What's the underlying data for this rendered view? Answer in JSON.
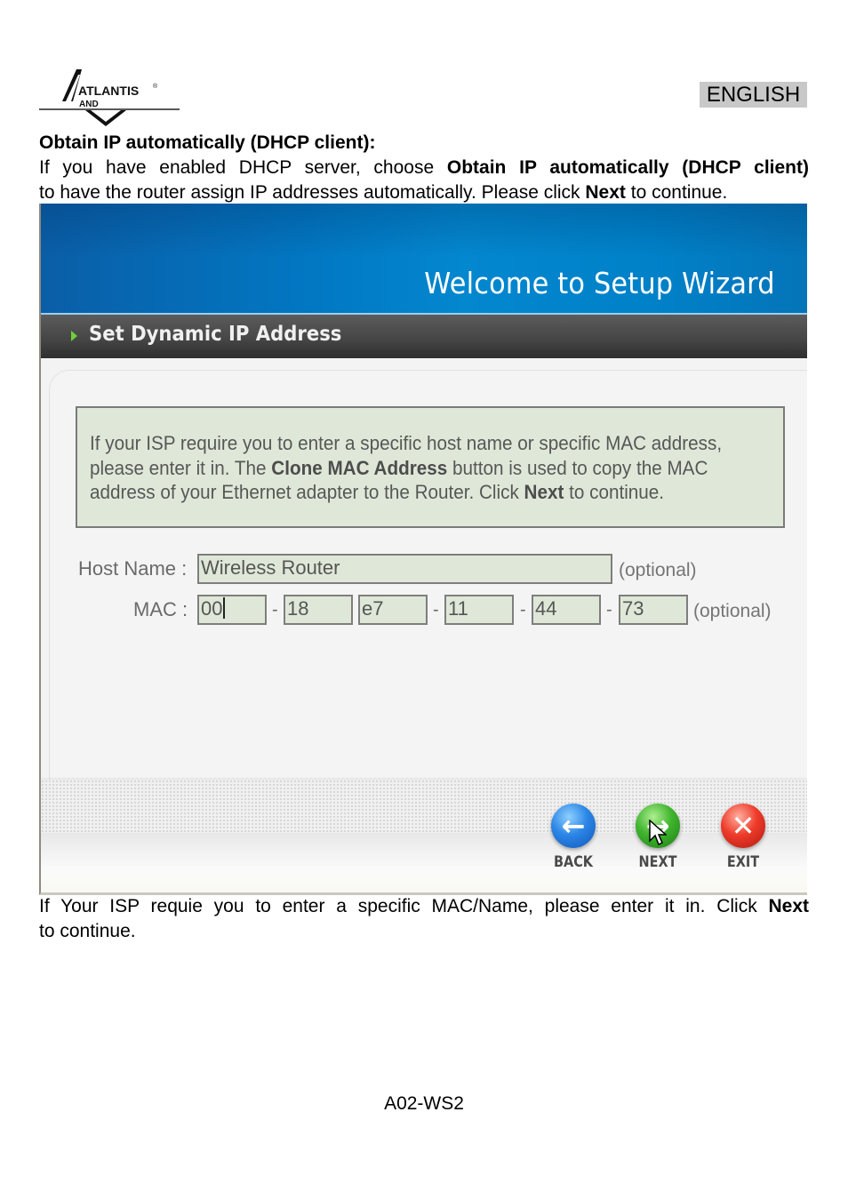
{
  "header": {
    "logo_text": "ATLANTIS",
    "logo_subtext": "AND",
    "logo_registered": "®",
    "language_badge": "ENGLISH"
  },
  "document": {
    "heading": "Obtain IP automatically (DHCP client):",
    "para1": {
      "part1": "If you have enabled DHCP server, choose ",
      "bold1": "Obtain IP automatically (DHCP client)",
      "part2": "to have the router assign IP addresses automatically. Please click ",
      "bold2": "Next",
      "part3": " to continue."
    },
    "para2": {
      "part1": "If Your ISP requie you to enter a specific MAC/Name, please enter it in. Click ",
      "bold1": "Next",
      "part2": "to continue."
    },
    "footer": "A02-WS2"
  },
  "wizard": {
    "banner_title": "Welcome to Setup Wizard",
    "section_title": "Set Dynamic IP Address",
    "info": {
      "line1": "If your ISP require you to enter a specific host name or specific MAC address,",
      "line2_part1": "please enter it in. The ",
      "line2_bold": "Clone MAC Address",
      "line2_part2": " button is used to copy the MAC",
      "line3_part1": "address of your Ethernet adapter to the Router. Click ",
      "line3_bold": "Next",
      "line3_part2": " to continue."
    },
    "host_name": {
      "label": "Host Name :",
      "value": "Wireless Router",
      "hint": "(optional)"
    },
    "mac": {
      "label": "MAC :",
      "octets": [
        "00",
        "18",
        "e7",
        "11",
        "44",
        "73"
      ],
      "separator": "-",
      "hint": "(optional)"
    },
    "buttons": {
      "back": "BACK",
      "next": "NEXT",
      "exit": "EXIT"
    },
    "colors": {
      "banner": "#0387cf",
      "section_bar": "#444444",
      "info_bg": "#dfe8d8",
      "back_orb": "#2b86e6",
      "next_orb": "#3fb42e",
      "exit_orb": "#ee3b2a"
    }
  }
}
